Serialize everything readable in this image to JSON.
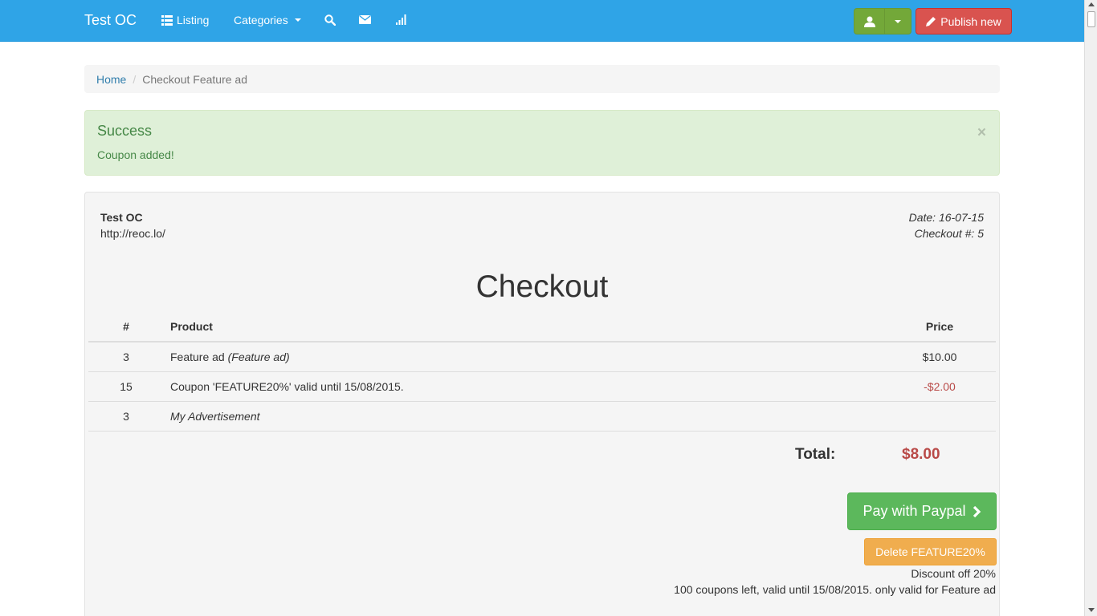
{
  "navbar": {
    "brand": "Test OC",
    "listing": "Listing",
    "categories": "Categories",
    "publish": "Publish new"
  },
  "breadcrumb": {
    "home": "Home",
    "current": "Checkout Feature ad"
  },
  "alert": {
    "title": "Success",
    "message": "Coupon added!",
    "close": "×"
  },
  "invoice": {
    "company": "Test OC",
    "url": "http://reoc.lo/",
    "date": "Date: 16-07-15",
    "checkout_no": "Checkout #: 5",
    "title": "Checkout",
    "headers": {
      "num": "#",
      "product": "Product",
      "price": "Price"
    },
    "rows": [
      {
        "num": "3",
        "product": "Feature ad",
        "product_note": "(Feature ad)",
        "price": "$10.00"
      },
      {
        "num": "15",
        "product": "Coupon 'FEATURE20%' valid until 15/08/2015.",
        "price": "-$2.00"
      },
      {
        "num": "3",
        "product": "My Advertisement",
        "price": ""
      }
    ],
    "total_label": "Total:",
    "total_value": "$8.00",
    "pay_button": "Pay with Paypal",
    "delete_button": "Delete FEATURE20%",
    "discount_line1": "Discount off 20%",
    "discount_line2": "100 coupons left, valid until 15/08/2015. only valid for Feature ad"
  },
  "colors": {
    "navbar": "#2fa4e7",
    "success_bg": "#dff0d8",
    "danger": "#d9534f",
    "green": "#5cb85c",
    "warning": "#f0ad4e",
    "negative_price": "#b94a48"
  },
  "icons": [
    "list-icon",
    "search-icon",
    "envelope-icon",
    "signal-icon",
    "user-icon",
    "pencil-icon",
    "chevron-right-icon"
  ]
}
